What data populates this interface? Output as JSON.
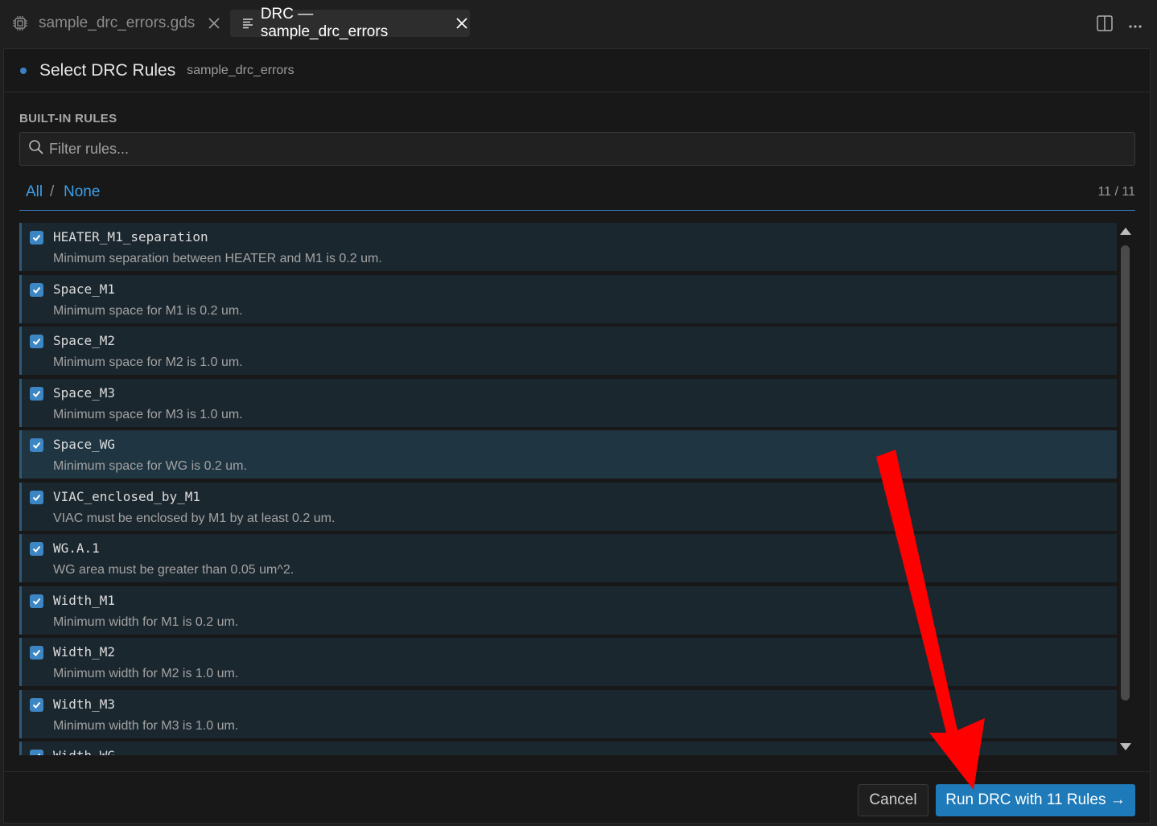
{
  "tabs": [
    {
      "label": "sample_drc_errors.gds",
      "icon": "chip-icon",
      "active": false
    },
    {
      "label": "DRC — sample_drc_errors",
      "icon": "lines-icon",
      "active": true
    }
  ],
  "header": {
    "title": "Select DRC Rules",
    "subtitle": "sample_drc_errors"
  },
  "section_label": "BUILT-IN RULES",
  "filter": {
    "placeholder": "Filter rules...",
    "value": ""
  },
  "selection": {
    "all_label": "All",
    "separator": "/",
    "none_label": "None",
    "count": "11 / 11"
  },
  "rules": [
    {
      "name": "HEATER_M1_separation",
      "desc": "Minimum separation between HEATER and M1 is 0.2 um.",
      "checked": true
    },
    {
      "name": "Space_M1",
      "desc": "Minimum space for M1 is 0.2 um.",
      "checked": true
    },
    {
      "name": "Space_M2",
      "desc": "Minimum space for M2 is 1.0 um.",
      "checked": true
    },
    {
      "name": "Space_M3",
      "desc": "Minimum space for M3 is 1.0 um.",
      "checked": true
    },
    {
      "name": "Space_WG",
      "desc": "Minimum space for WG is 0.2 um.",
      "checked": true
    },
    {
      "name": "VIAC_enclosed_by_M1",
      "desc": "VIAC must be enclosed by M1 by at least 0.2 um.",
      "checked": true
    },
    {
      "name": "WG.A.1",
      "desc": "WG area must be greater than 0.05 um^2.",
      "checked": true
    },
    {
      "name": "Width_M1",
      "desc": "Minimum width for M1 is 0.2 um.",
      "checked": true
    },
    {
      "name": "Width_M2",
      "desc": "Minimum width for M2 is 1.0 um.",
      "checked": true
    },
    {
      "name": "Width_M3",
      "desc": "Minimum width for M3 is 1.0 um.",
      "checked": true
    },
    {
      "name": "Width_WG",
      "desc": "",
      "checked": true
    }
  ],
  "footer": {
    "cancel_label": "Cancel",
    "run_label": "Run DRC with 11 Rules →"
  },
  "colors": {
    "accent": "#1e7ab8",
    "link": "#3d9ee8",
    "annotation_arrow": "#ff0000"
  }
}
